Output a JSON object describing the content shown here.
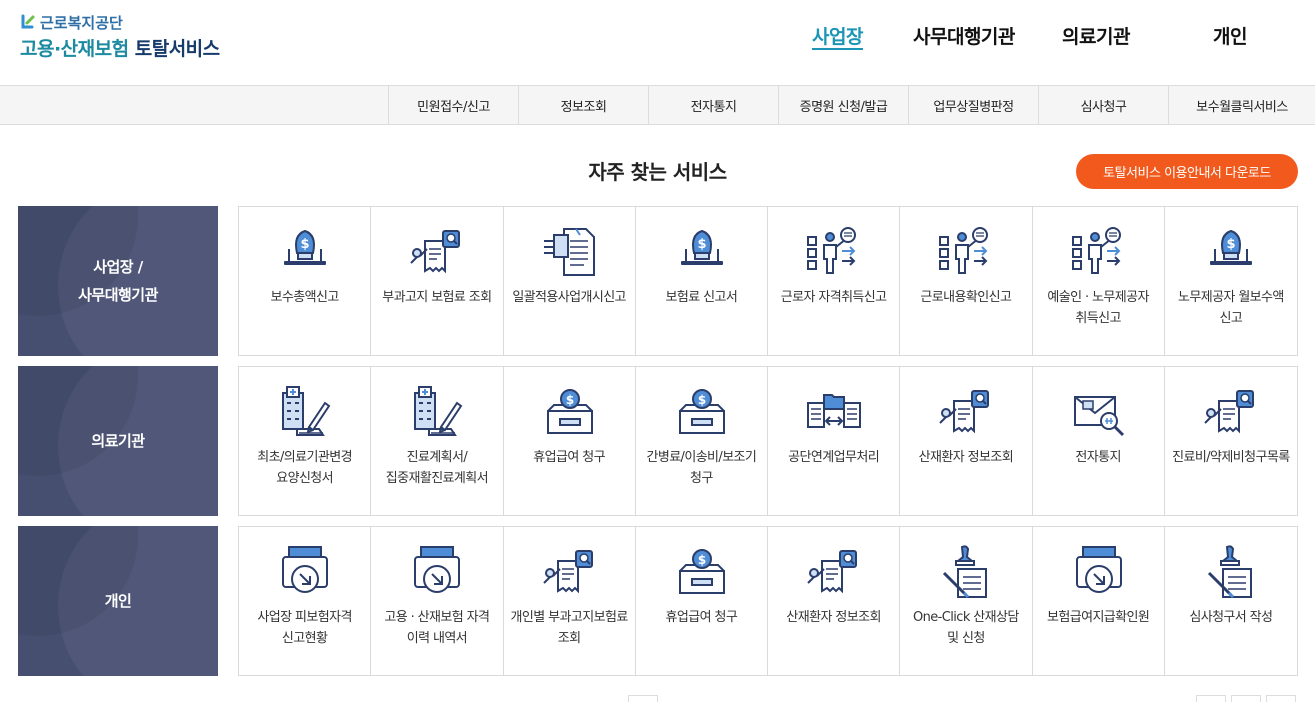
{
  "logo": {
    "org": "근로복지공단",
    "service_teal": "고용·산재보험",
    "service_navy": "토탈서비스"
  },
  "topnav": [
    "사업장",
    "사무대행기관",
    "의료기관",
    "개인"
  ],
  "subnav": [
    "민원접수/신고",
    "정보조회",
    "전자통지",
    "증명원 신청/발급",
    "업무상질병판정",
    "심사청구",
    "보수월클릭서비스"
  ],
  "section_title": "자주 찾는 서비스",
  "guide_button": "토탈서비스 이용안내서 다운로드",
  "colors": {
    "accent_teal": "#1b95b5",
    "category_bg": "#474f71",
    "orange": "#f25a1d",
    "icon_navy": "#2b3d6b",
    "icon_blue": "#4f8ed6"
  },
  "rows": [
    {
      "category": "사업장 /\n사무대행기관",
      "items": [
        {
          "label": "보수총액신고",
          "icon": "money-laptop-icon"
        },
        {
          "label": "부과고지 보험료 조회",
          "icon": "document-search-icon"
        },
        {
          "label": "일괄적용사업개시신고",
          "icon": "document-transfer-icon"
        },
        {
          "label": "보험료 신고서",
          "icon": "money-laptop-icon"
        },
        {
          "label": "근로자 자격취득신고",
          "icon": "presenter-board-icon"
        },
        {
          "label": "근로내용확인신고",
          "icon": "presenter-board-icon"
        },
        {
          "label": "예술인 · 노무제공자 취득신고",
          "icon": "presenter-board-icon"
        },
        {
          "label": "노무제공자 월보수액 신고",
          "icon": "money-laptop-icon"
        }
      ]
    },
    {
      "category": "의료기관",
      "items": [
        {
          "label": "최초/의료기관변경 요양신청서",
          "icon": "hospital-pen-icon"
        },
        {
          "label": "진료계획서/집중재활진료계획서",
          "icon": "hospital-pen-icon"
        },
        {
          "label": "휴업급여 청구",
          "icon": "money-box-icon"
        },
        {
          "label": "간병료/이송비/보조기 청구",
          "icon": "money-box-icon"
        },
        {
          "label": "공단연계업무처리",
          "icon": "document-exchange-icon"
        },
        {
          "label": "산재환자 정보조회",
          "icon": "document-search-icon"
        },
        {
          "label": "전자통지",
          "icon": "envelope-search-icon"
        },
        {
          "label": "진료비/약제비청구목록",
          "icon": "document-search-icon"
        }
      ]
    },
    {
      "category": "개인",
      "items": [
        {
          "label": "사업장 피보험자격 신고현황",
          "icon": "printer-arrow-icon"
        },
        {
          "label": "고용 · 산재보험 자격 이력 내역서",
          "icon": "printer-arrow-icon"
        },
        {
          "label": "개인별 부과고지보험료 조회",
          "icon": "document-search-icon"
        },
        {
          "label": "휴업급여 청구",
          "icon": "money-box-icon"
        },
        {
          "label": "산재환자 정보조회",
          "icon": "document-search-icon"
        },
        {
          "label": "One-Click 산재상담 및 신청",
          "icon": "stamp-document-icon"
        },
        {
          "label": "보험급여지급확인원",
          "icon": "printer-arrow-icon"
        },
        {
          "label": "심사청구서 작성",
          "icon": "stamp-document-icon"
        }
      ]
    }
  ]
}
